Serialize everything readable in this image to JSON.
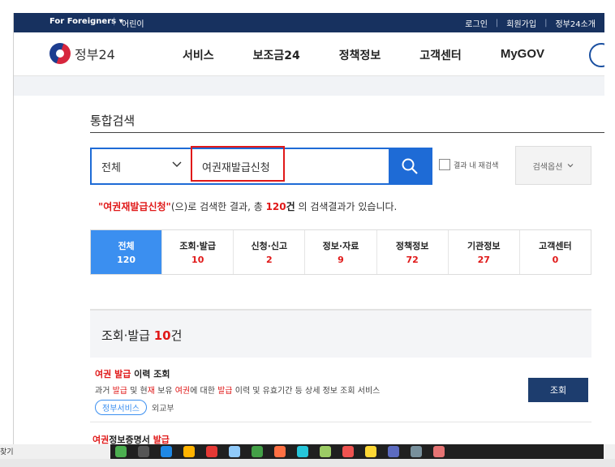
{
  "topbar": {
    "for_foreigners": "For Foreigners ▾",
    "kids": "어린이",
    "login": "로그인",
    "signup": "회원가입",
    "about": "정부24소개"
  },
  "header": {
    "logo_text": "정부24",
    "nav": [
      "서비스",
      "보조금24",
      "정책정보",
      "고객센터",
      "MyGOV"
    ]
  },
  "search": {
    "page_title": "통합검색",
    "scope": "전체",
    "query": "여권재발급신청",
    "within_results": "결과 내 재검색",
    "options": "검색옵션"
  },
  "summary": {
    "quote_open": "\"",
    "keyword": "여권재발급신청",
    "quote_close": "\"",
    "mid": "(으)로 검색한 결과, 총 ",
    "total": "120",
    "unit": "건",
    "tail": " 의 검색결과가 있습니다."
  },
  "tabs": [
    {
      "label": "전체",
      "count": "120"
    },
    {
      "label": "조회·발급",
      "count": "10"
    },
    {
      "label": "신청·신고",
      "count": "2"
    },
    {
      "label": "정보·자료",
      "count": "9"
    },
    {
      "label": "정책정보",
      "count": "72"
    },
    {
      "label": "기관정보",
      "count": "27"
    },
    {
      "label": "고객센터",
      "count": "0"
    }
  ],
  "section": {
    "title": "조회·발급 ",
    "count": "10",
    "unit": "건"
  },
  "results": [
    {
      "title_parts": [
        "여권",
        " ",
        "발급",
        " 이력 조회"
      ],
      "desc_parts": [
        "과거 ",
        "발급",
        " 및 현",
        "재",
        " 보유 ",
        "여권",
        "에 대한 ",
        "발급",
        " 이력 및 유효기간 등 상세 정보 조회 서비스"
      ],
      "badge": "정부서비스",
      "agency": "외교부",
      "button": "조회"
    },
    {
      "title_parts": [
        "여권",
        "정보증명서 ",
        "발급"
      ]
    }
  ],
  "taskbar": {
    "left_text": "찾기"
  },
  "colors": {
    "accent": "#1e6bd6",
    "highlight": "#e01919",
    "topbar": "#17315f",
    "active_tab": "#3b8ff0"
  }
}
